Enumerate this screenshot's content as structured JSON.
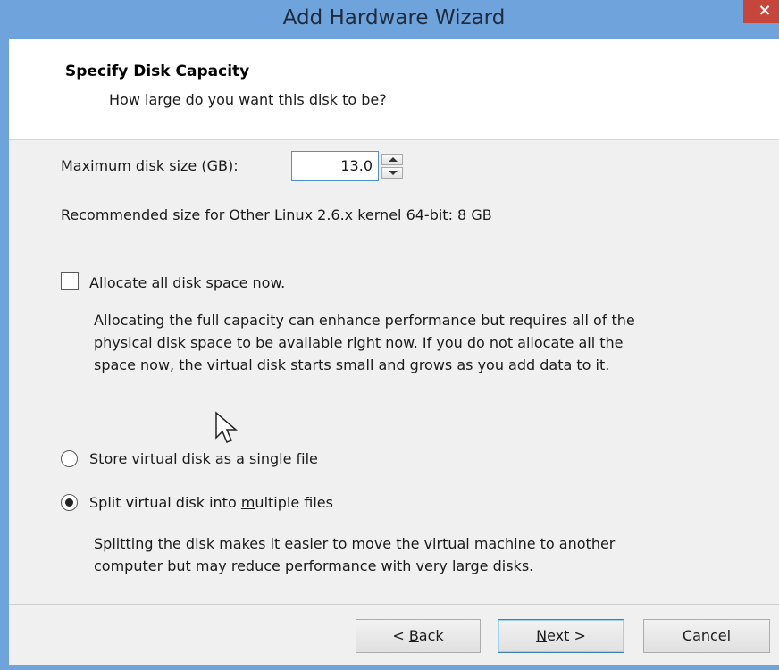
{
  "window": {
    "title": "Add Hardware Wizard",
    "close_glyph": "×"
  },
  "header": {
    "title": "Specify Disk Capacity",
    "subtitle": "How large do you want this disk to be?"
  },
  "disk_size": {
    "label_prefix": "Maximum disk ",
    "label_mnemonic": "s",
    "label_suffix": "ize (GB):",
    "value": "13.0"
  },
  "recommended_text": "Recommended size for Other Linux 2.6.x kernel 64-bit: 8 GB",
  "allocate": {
    "mnemonic": "A",
    "label_rest": "llocate all disk space now.",
    "checked": false,
    "description": [
      "Allocating the full capacity can enhance performance but requires all of the",
      "physical disk space to be available right now. If you do not allocate all the",
      "space now, the virtual disk starts small and grows as you add data to it."
    ]
  },
  "storage_options": {
    "single": {
      "label_prefix": "St",
      "label_mnemonic": "o",
      "label_suffix": "re virtual disk as a single file",
      "selected": false
    },
    "multiple": {
      "label_prefix": "Split virtual disk into ",
      "label_mnemonic": "m",
      "label_suffix": "ultiple files",
      "selected": true
    },
    "description": [
      "Splitting the disk makes it easier to move the virtual machine to another",
      "computer but may reduce performance with very large disks."
    ]
  },
  "buttons": {
    "back": {
      "prefix": "< ",
      "mnemonic": "B",
      "suffix": "ack"
    },
    "next": {
      "mnemonic": "N",
      "suffix": "ext >"
    },
    "cancel": "Cancel"
  },
  "colors": {
    "titlebar": "#6fa3dc",
    "close_button": "#c7463b",
    "input_focus_border": "#4f90d4"
  }
}
